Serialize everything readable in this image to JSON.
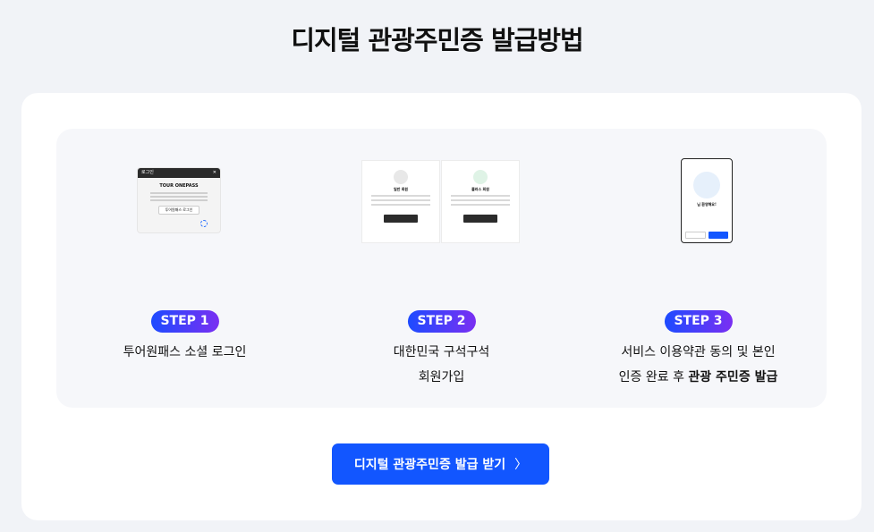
{
  "page": {
    "title": "디지털 관광주민증 발급방법"
  },
  "steps": [
    {
      "badge": "STEP 1",
      "line1": "투어원패스 소셜 로그인"
    },
    {
      "badge": "STEP 2",
      "line1": "대한민국 구석구석",
      "line2": "회원가입"
    },
    {
      "badge": "STEP 3",
      "line1": "서비스 이용약관 동의 및 본인",
      "line2_prefix": "인증 완료 후 ",
      "line2_bold": "관광 주민증 발급"
    }
  ],
  "thumbs": {
    "login": {
      "bar_title": "로그인",
      "close": "✕",
      "logo": "TOUR ONEPASS",
      "button": "투어원패스 로그인"
    },
    "signup": {
      "pane1_title": "일반 회원",
      "pane2_title": "플러스 회원"
    },
    "mobile": {
      "hello": "님 환영해요!"
    }
  },
  "cta": {
    "label": "디지털 관광주민증 발급 받기",
    "chevron": "〉"
  },
  "colors": {
    "primary": "#1256ff",
    "badge_start": "#1d4bff",
    "badge_end": "#7a2ff2"
  }
}
